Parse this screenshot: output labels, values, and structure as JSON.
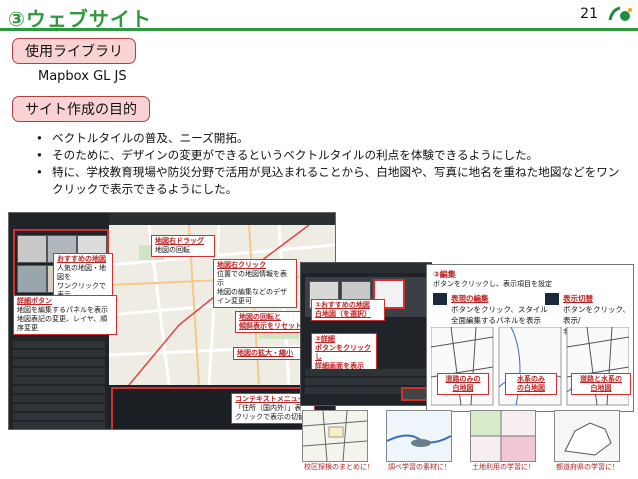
{
  "header": {
    "title": "③ウェブサイト",
    "page_number": "21"
  },
  "sections": {
    "library_label": "使用ライブラリ",
    "library_name": "Mapbox GL JS",
    "purpose_label": "サイト作成の目的"
  },
  "bullets": [
    "ベクトルタイルの普及、ニーズ開拓。",
    "そのために、デザインの変更ができるというベクトルタイルの利点を体験できるようにした。",
    "特に、学校教育現場や防災分野で活用が見込まれることから、白地図や、写真に地名を重ねた地図などをワンクリックで表示できるようにした。"
  ],
  "shot1": {
    "callouts": {
      "recommended": {
        "title": "おすすめの地図",
        "body": "人気の地図・地図を\nワンクリックで表示"
      },
      "detail": {
        "title": "詳細ボタン",
        "body": "地図を編集するパネルを表示\n地図表記の変更、レイヤ、順序変更"
      },
      "right_drag": {
        "title": "地図右ドラッグ",
        "body": "地図の回転"
      },
      "right_click": {
        "title": "地図右クリック",
        "body": "位置での地図情報を表示\n地図の編集などのデザイン変更可"
      },
      "rotate_reset": {
        "title": "地図の回転と\n傾斜表示をリセット"
      },
      "zoom": {
        "title": "地図の拡大・縮小"
      },
      "context": {
        "title": "コンテキストメニュー",
        "body": "「住所（国内外）」表\nクリックで表示の切替"
      }
    }
  },
  "shot2": {
    "callouts": {
      "recommended": "①おすすめの地図\n白地図（を選択）",
      "detail": "②詳細\nボタンをクリックし\n詳細画面を表示"
    }
  },
  "shot3": {
    "edit_heading": "③編集",
    "edit_desc": "ボタンをクリックし、表示項目を設定",
    "display_edit": {
      "title": "表現の編集",
      "body": "ボタンをクリック、スタイル\n全面編集するパネルを表示"
    },
    "toggle": {
      "title": "表示切替",
      "body": "ボタンをクリック、表示/\n非表示を切り替え"
    },
    "labels": [
      "道路のみの\n白地図",
      "水系のみ\nの白地図",
      "道路と水系の\n白地図"
    ]
  },
  "bottom_captions": [
    "校区探検のまとめに！",
    "調べ学習の素材に！",
    "土地利用の学習に！",
    "都道府県の学習に！"
  ],
  "colors": {
    "accent": "#2f9a3d",
    "pill_bg": "#f9d3d3",
    "callout_red": "#d03030"
  }
}
